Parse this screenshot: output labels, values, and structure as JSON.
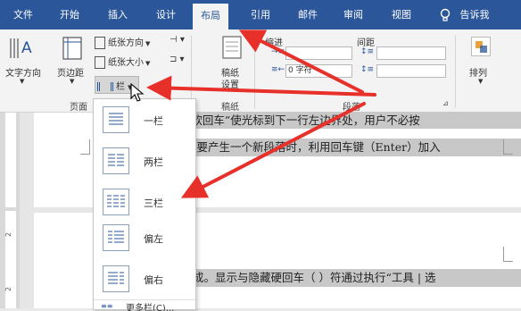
{
  "tabs": [
    "文件",
    "开始",
    "插入",
    "设计",
    "布局",
    "引用",
    "邮件",
    "审阅",
    "视图",
    "告诉我"
  ],
  "active_tab": "布局",
  "ribbon": {
    "text_direction": "文字方向",
    "margins": "页边距",
    "orientation": "纸张方向",
    "size": "纸张大小",
    "columns": "栏",
    "manuscript_line1": "稿纸",
    "manuscript_line2": "设置",
    "indent_label": "缩进",
    "spacing_label": "间距",
    "indent_right_value": "0 字符",
    "arrange": "排列",
    "group_page_setup": "页面",
    "group_manuscript": "稿纸",
    "group_paragraph": "段落"
  },
  "dropdown": {
    "items": [
      "一栏",
      "两栏",
      "三栏",
      "偏左",
      "偏右"
    ],
    "more": "更多栏(C)..."
  },
  "document": {
    "line1": "“软回车”使光标到下一行左边界处，用户不必按",
    "line2": "当要产生一个新段落时，利用回车键（Enter）加入",
    "line3": "成。显示与隐藏硬回车（  ）符通过执行“工具 | 选",
    "ruler_marks": [
      "2",
      "2"
    ]
  },
  "colors": {
    "tabbar": "#2b579a",
    "ribbon": "#f3f3f3",
    "arrow": "#e8302a",
    "highlight": "#c8c8c8"
  }
}
